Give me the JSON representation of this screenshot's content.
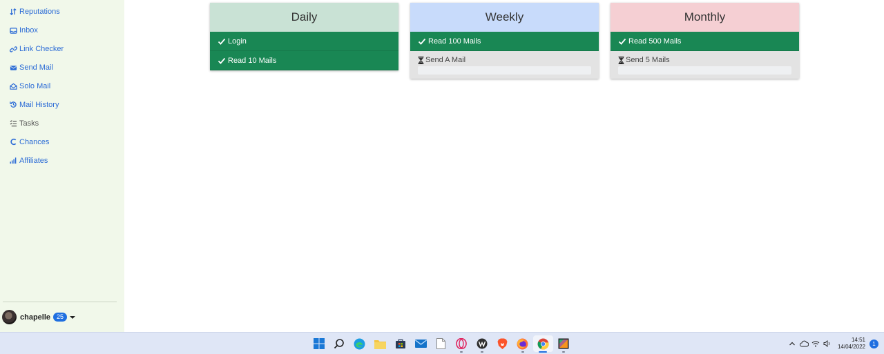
{
  "sidebar": {
    "items": [
      {
        "label": "Reputations",
        "icon": "sort-arrows-icon"
      },
      {
        "label": "Inbox",
        "icon": "inbox-icon"
      },
      {
        "label": "Link Checker",
        "icon": "link-icon"
      },
      {
        "label": "Send Mail",
        "icon": "envelope-icon"
      },
      {
        "label": "Solo Mail",
        "icon": "envelope-open-icon"
      },
      {
        "label": "Mail History",
        "icon": "history-icon"
      },
      {
        "label": "Tasks",
        "icon": "task-list-icon"
      },
      {
        "label": "Chances",
        "icon": "c-icon"
      },
      {
        "label": "Affiliates",
        "icon": "bar-signal-icon"
      }
    ],
    "user": {
      "name": "chapelle",
      "badge": "25"
    }
  },
  "cards": {
    "daily": {
      "title": "Daily",
      "header_color": "#c9e2d5",
      "done": [
        "Login",
        "Read 10 Mails"
      ]
    },
    "weekly": {
      "title": "Weekly",
      "header_color": "#c8dbfb",
      "done": [
        "Read 100 Mails"
      ],
      "pending": {
        "label": "Send A Mail",
        "progress": 0
      }
    },
    "monthly": {
      "title": "Monthly",
      "header_color": "#f5cfd3",
      "done": [
        "Read 500 Mails"
      ],
      "pending": {
        "label": "Send 5 Mails",
        "progress": 0
      }
    }
  },
  "colors": {
    "done": "#198754",
    "pending": "#e3e3e3",
    "link": "#2b6bd6"
  },
  "taskbar": {
    "apps": [
      "windows-start-icon",
      "search-icon",
      "edge-icon",
      "file-explorer-icon",
      "store-icon",
      "mail-icon",
      "notepad-icon",
      "opera-icon",
      "wordpress-icon",
      "brave-icon",
      "firefox-icon",
      "chrome-icon",
      "paint-icon"
    ],
    "time": "14:51",
    "date": "14/04/2022",
    "notifications": "1"
  }
}
